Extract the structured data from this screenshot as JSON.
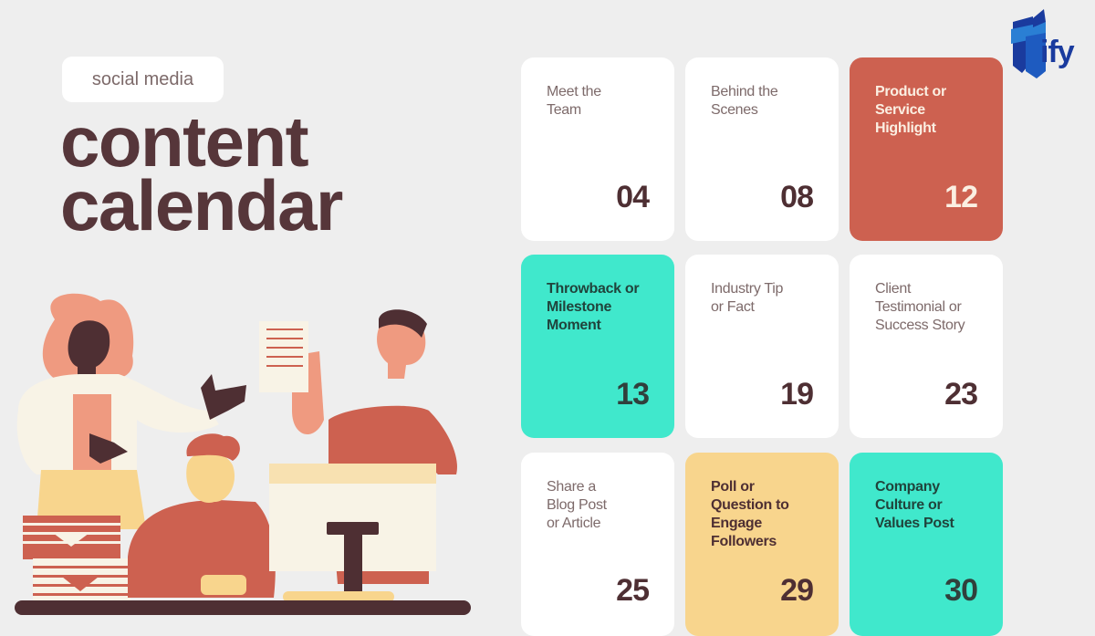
{
  "header": {
    "tag_label": "social media",
    "title_line1": "content",
    "title_line2": "calendar"
  },
  "logo": {
    "text": "ify",
    "icon": "tify-logo-icon",
    "color": "#1a3b9e"
  },
  "calendar": {
    "cards": [
      {
        "label": "Meet the\nTeam",
        "day": "04",
        "style": "white"
      },
      {
        "label": "Behind the\nScenes",
        "day": "08",
        "style": "white"
      },
      {
        "label": "Product or\nService\nHighlight",
        "day": "12",
        "style": "red"
      },
      {
        "label": "Throwback or\nMilestone\nMoment",
        "day": "13",
        "style": "teal"
      },
      {
        "label": "Industry Tip\nor Fact",
        "day": "19",
        "style": "white"
      },
      {
        "label": "Client\nTestimonial or\nSuccess Story",
        "day": "23",
        "style": "white"
      },
      {
        "label": "Share a\nBlog Post\nor Article",
        "day": "25",
        "style": "white"
      },
      {
        "label": "Poll or\nQuestion to\nEngage\nFollowers",
        "day": "29",
        "style": "yellow"
      },
      {
        "label": "Company\nCulture or\nValues Post",
        "day": "30",
        "style": "teal"
      }
    ]
  },
  "colors": {
    "background": "#eeeeee",
    "title": "#56363a",
    "red": "#cd6150",
    "teal": "#40e8cc",
    "yellow": "#f8d58d"
  },
  "illustration": {
    "icon": "office-team-illustration"
  }
}
